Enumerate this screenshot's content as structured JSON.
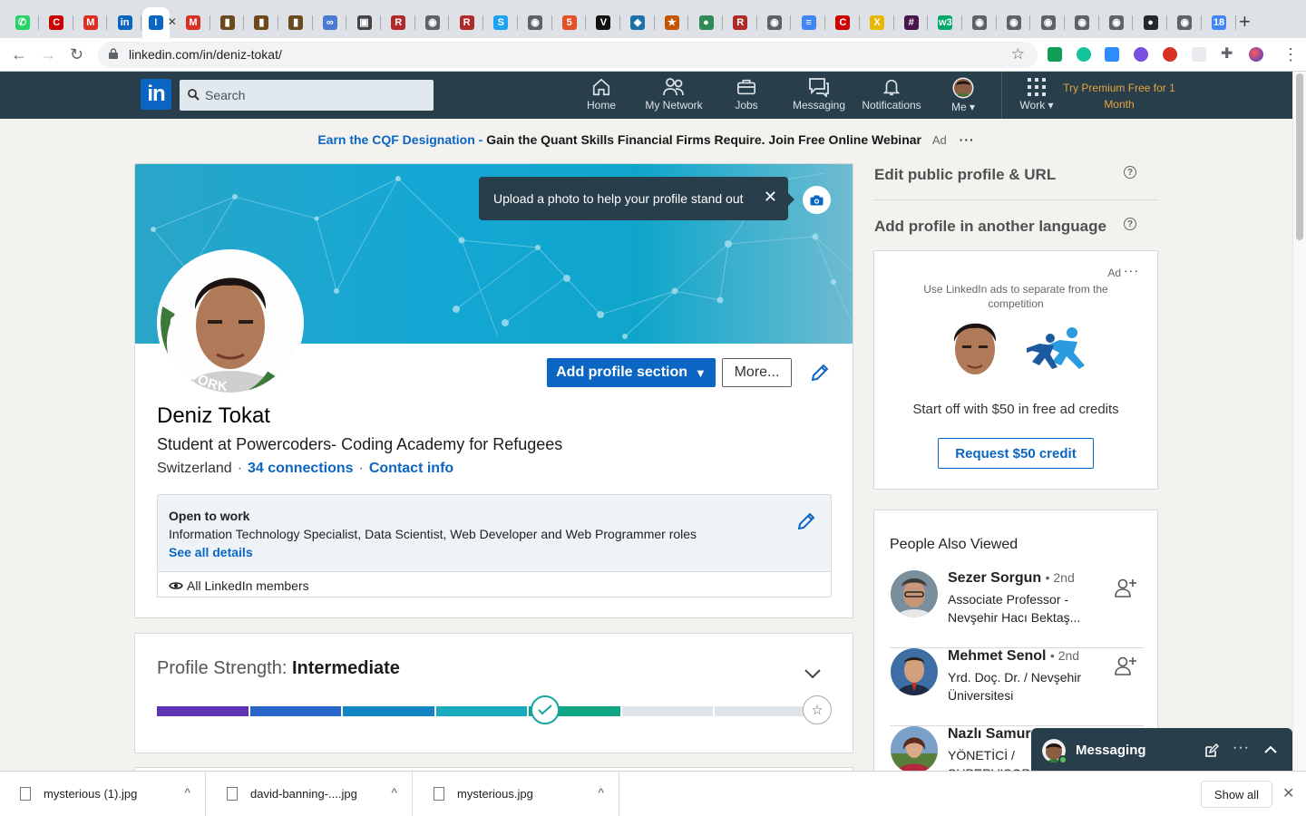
{
  "browser": {
    "tabs": [
      {
        "icon": "whatsapp-icon",
        "color": "#25d366",
        "glyph": "✆"
      },
      {
        "icon": "canon-icon",
        "color": "#cc0000",
        "glyph": "C"
      },
      {
        "icon": "gmail-icon",
        "color": "#d93025",
        "glyph": "M"
      },
      {
        "icon": "linkedin-icon",
        "color": "#0a66c2",
        "glyph": "in"
      },
      {
        "icon": "linkedin-active-tab-icon",
        "color": "#0a66c2",
        "glyph": "I",
        "active": true
      },
      {
        "icon": "gmail-icon",
        "color": "#d93025",
        "glyph": "M"
      },
      {
        "icon": "image-icon",
        "color": "#6b4a1e",
        "glyph": "▮"
      },
      {
        "icon": "image-icon",
        "color": "#6b4a1e",
        "glyph": "▮"
      },
      {
        "icon": "image-icon",
        "color": "#6b4a1e",
        "glyph": "▮"
      },
      {
        "icon": "link-icon",
        "color": "#4a7bd0",
        "glyph": "∞"
      },
      {
        "icon": "contacts-icon",
        "color": "#444444",
        "glyph": "▣"
      },
      {
        "icon": "r-icon",
        "color": "#b02a2a",
        "glyph": "R"
      },
      {
        "icon": "globe-icon",
        "color": "#5f6368",
        "glyph": "◉"
      },
      {
        "icon": "r-icon",
        "color": "#b02a2a",
        "glyph": "R"
      },
      {
        "icon": "s-icon",
        "color": "#1da1f2",
        "glyph": "S"
      },
      {
        "icon": "globe-icon",
        "color": "#5f6368",
        "glyph": "◉"
      },
      {
        "icon": "html5-icon",
        "color": "#e34f26",
        "glyph": "5"
      },
      {
        "icon": "v-icon",
        "color": "#111111",
        "glyph": "V"
      },
      {
        "icon": "drop-icon",
        "color": "#1a73a8",
        "glyph": "◆"
      },
      {
        "icon": "star-icon",
        "color": "#c45500",
        "glyph": "★"
      },
      {
        "icon": "leaf-icon",
        "color": "#2e8b57",
        "glyph": "●"
      },
      {
        "icon": "r-icon",
        "color": "#b02a2a",
        "glyph": "R"
      },
      {
        "icon": "globe-icon",
        "color": "#5f6368",
        "glyph": "◉"
      },
      {
        "icon": "docs-icon",
        "color": "#4285f4",
        "glyph": "≡"
      },
      {
        "icon": "canon-icon",
        "color": "#cc0000",
        "glyph": "C"
      },
      {
        "icon": "x-icon",
        "color": "#e6b800",
        "glyph": "X"
      },
      {
        "icon": "slack-icon",
        "color": "#4a154b",
        "glyph": "#"
      },
      {
        "icon": "w3-icon",
        "color": "#04aa6d",
        "glyph": "w3"
      },
      {
        "icon": "globe-icon",
        "color": "#5f6368",
        "glyph": "◉"
      },
      {
        "icon": "globe-icon",
        "color": "#5f6368",
        "glyph": "◉"
      },
      {
        "icon": "globe-icon",
        "color": "#5f6368",
        "glyph": "◉"
      },
      {
        "icon": "globe-icon",
        "color": "#5f6368",
        "glyph": "◉"
      },
      {
        "icon": "globe-icon",
        "color": "#5f6368",
        "glyph": "◉"
      },
      {
        "icon": "github-icon",
        "color": "#24292e",
        "glyph": "●"
      },
      {
        "icon": "globe-icon",
        "color": "#5f6368",
        "glyph": "◉"
      },
      {
        "icon": "calendar-icon",
        "color": "#4285f4",
        "glyph": "18"
      }
    ],
    "url": "linkedin.com/in/deniz-tokat/"
  },
  "nav": {
    "search_placeholder": "Search",
    "items": [
      "Home",
      "My Network",
      "Jobs",
      "Messaging",
      "Notifications",
      "Me"
    ],
    "work": "Work",
    "premium": "Try Premium Free for 1 Month"
  },
  "top_ad": {
    "link": "Earn the CQF Designation -",
    "text": "Gain the Quant Skills Financial Firms Require. Join Free Online Webinar",
    "ad_label": "Ad",
    "more": "···"
  },
  "profile": {
    "tooltip": "Upload a photo to help your profile stand out",
    "avatar_frame": "#OPENTOWORK",
    "add_section": "Add profile section",
    "more_button": "More...",
    "name": "Deniz Tokat",
    "headline": "Student at Powercoders- Coding Academy for Refugees",
    "location": "Switzerland",
    "connections": "34 connections",
    "contact_info": "Contact info",
    "open_to_work": {
      "title": "Open to work",
      "roles": "Information Technology Specialist, Data Scientist, Web Developer and Web Programmer roles",
      "see_all": "See all details",
      "visibility": "All LinkedIn members"
    }
  },
  "strength": {
    "label": "Profile Strength:",
    "level": "Intermediate",
    "segments_filled": 5,
    "segments_total": 7,
    "colors": [
      "#5c33b5",
      "#2867c9",
      "#1485c4",
      "#19abbd",
      "#10a583",
      "#dde4ea",
      "#dde4ea"
    ]
  },
  "rail": {
    "edit_public": "Edit public profile & URL",
    "add_language": "Add profile in another language",
    "ad": {
      "label": "Ad",
      "more": "···",
      "copy": "Use LinkedIn ads to separate from the competition",
      "offer": "Start off with $50 in free ad credits",
      "cta": "Request $50 credit"
    },
    "people_also_viewed": {
      "title": "People Also Viewed",
      "people": [
        {
          "name": "Sezer Sorgun",
          "degree": "• 2nd",
          "title": "Associate Professor - Nevşehir Hacı Bektaş..."
        },
        {
          "name": "Mehmet Senol",
          "degree": "• 2nd",
          "title": "Yrd. Doç. Dr. / Nevşehir Üniversitesi"
        },
        {
          "name": "Nazlı Samur",
          "degree": "",
          "title": "YÖNETİCİ / SUPERVISOR"
        }
      ]
    }
  },
  "messaging": {
    "title": "Messaging"
  },
  "downloads": {
    "files": [
      "mysterious (1).jpg",
      "david-banning-....jpg",
      "mysterious.jpg"
    ],
    "show_all": "Show all"
  }
}
